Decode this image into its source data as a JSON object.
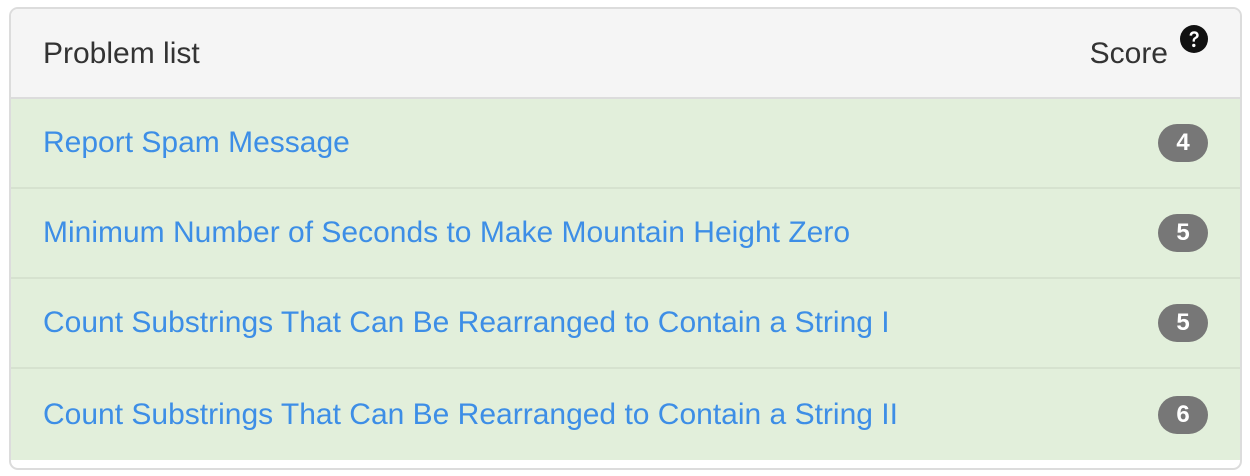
{
  "header": {
    "title": "Problem list",
    "score_label": "Score",
    "help_icon": "question-circle-icon"
  },
  "problems": [
    {
      "title": "Report Spam Message",
      "score": "4"
    },
    {
      "title": "Minimum Number of Seconds to Make Mountain Height Zero",
      "score": "5"
    },
    {
      "title": "Count Substrings That Can Be Rearranged to Contain a String I",
      "score": "5"
    },
    {
      "title": "Count Substrings That Can Be Rearranged to Contain a String II",
      "score": "6"
    }
  ],
  "colors": {
    "row_background": "#e2efdb",
    "link": "#3d8ee6",
    "badge": "#777777",
    "header_background": "#f5f5f5"
  }
}
